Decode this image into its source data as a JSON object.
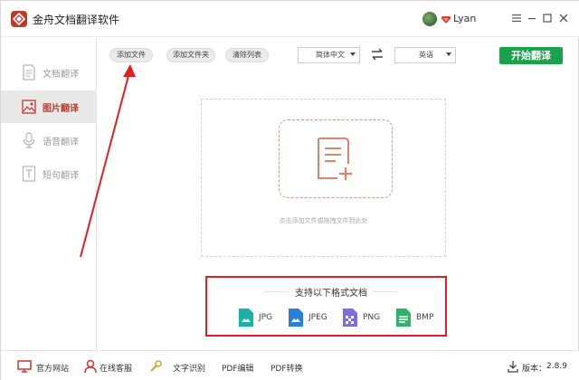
{
  "titlebar": {
    "app_title": "金舟文档翻译软件",
    "username": "Lyan",
    "brand_color": "#c0392b"
  },
  "sidebar": {
    "items": [
      {
        "label": "文档翻译",
        "icon": "document-icon",
        "active": false
      },
      {
        "label": "图片翻译",
        "icon": "image-icon",
        "active": true
      },
      {
        "label": "语音翻译",
        "icon": "microphone-icon",
        "active": false
      },
      {
        "label": "短句翻译",
        "icon": "text-icon",
        "active": false
      }
    ]
  },
  "toolbar": {
    "add_file": "添加文件",
    "add_folder": "添加文件夹",
    "clear_list": "清除列表",
    "source_lang": "简体中文",
    "target_lang": "英语",
    "start": "开始翻译",
    "start_color": "#1aa34a"
  },
  "dropzone": {
    "hint": "点击添加文件或拖拽文件到此处"
  },
  "formats": {
    "title": "支持以下格式文档",
    "items": [
      {
        "label": "JPG",
        "color": "#1bb1a8"
      },
      {
        "label": "JPEG",
        "color": "#2a7fd8"
      },
      {
        "label": "PNG",
        "color": "#7a6fe0"
      },
      {
        "label": "BMP",
        "color": "#2fb36a"
      }
    ]
  },
  "footer": {
    "official_site": "官方网站",
    "online_support": "在线客服",
    "ocr": "文字识别",
    "pdf_edit": "PDF编辑",
    "pdf_convert": "PDF转换",
    "version_label": "版本：",
    "version": "2.8.9"
  }
}
